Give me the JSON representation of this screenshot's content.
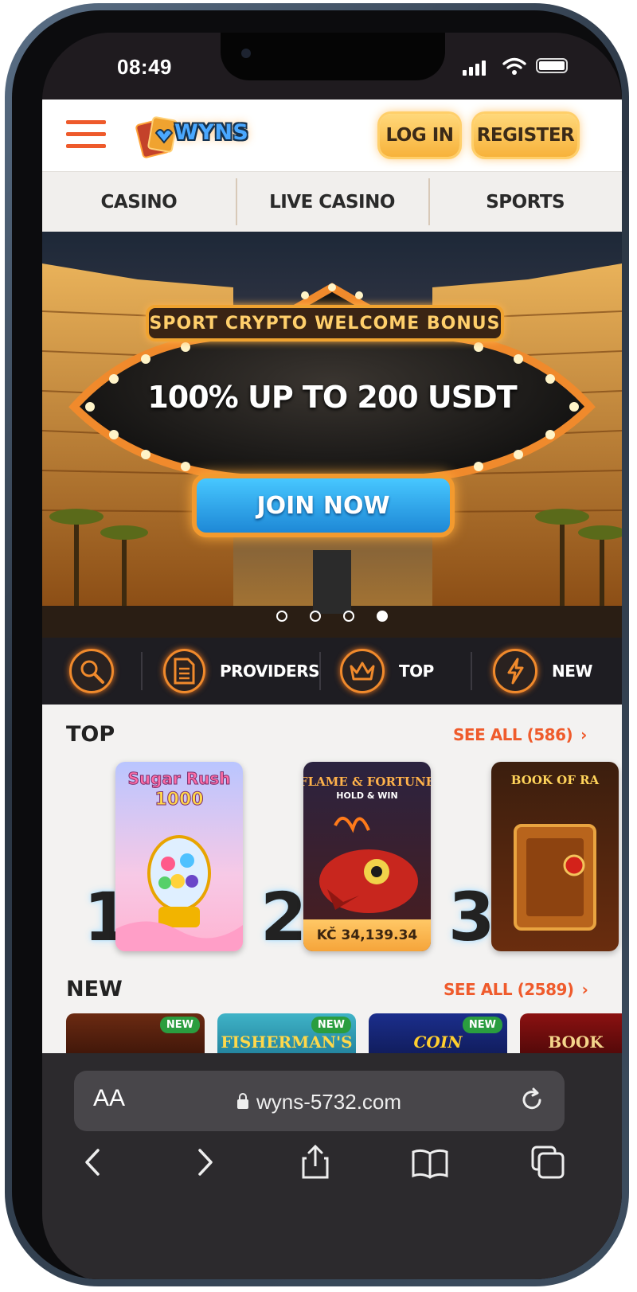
{
  "status_bar": {
    "time": "08:49"
  },
  "header": {
    "logo_text": "WYNS",
    "login_label": "LOG IN",
    "register_label": "REGISTER"
  },
  "categories": [
    "CASINO",
    "LIVE CASINO",
    "SPORTS"
  ],
  "hero": {
    "badge": "SPORT CRYPTO WELCOME BONUS",
    "title": "100% UP TO 200 USDT",
    "cta": "JOIN NOW",
    "slides": 4,
    "active_slide": 4
  },
  "quick_nav": {
    "items": [
      {
        "icon": "search-icon",
        "label": ""
      },
      {
        "icon": "document-icon",
        "label": "PROVIDERS"
      },
      {
        "icon": "crown-icon",
        "label": "TOP"
      },
      {
        "icon": "lightning-icon",
        "label": "NEW"
      }
    ]
  },
  "top_section": {
    "title": "TOP",
    "see_all": "SEE ALL (586)",
    "games": [
      {
        "rank": "1",
        "title": "Sugar Rush 1000",
        "jackpot": ""
      },
      {
        "rank": "2",
        "title": "FLAME & FORTUNE HOLD & WIN",
        "jackpot": "KČ 34,139.34"
      },
      {
        "rank": "3",
        "title": "BOOK OF RA",
        "jackpot": ""
      }
    ]
  },
  "new_section": {
    "title": "NEW",
    "see_all": "SEE ALL (2589)",
    "badge": "NEW",
    "games": [
      "",
      "FISHERMAN'S",
      "COIN",
      "BOOK"
    ]
  },
  "browser": {
    "aa_label": "AA",
    "url": "wyns-5732.com"
  },
  "colors": {
    "accent": "#ee5a2b",
    "button_yellow": "#f7b23b",
    "cta_blue": "#1e88d6",
    "dark_nav": "#1e1d22"
  }
}
